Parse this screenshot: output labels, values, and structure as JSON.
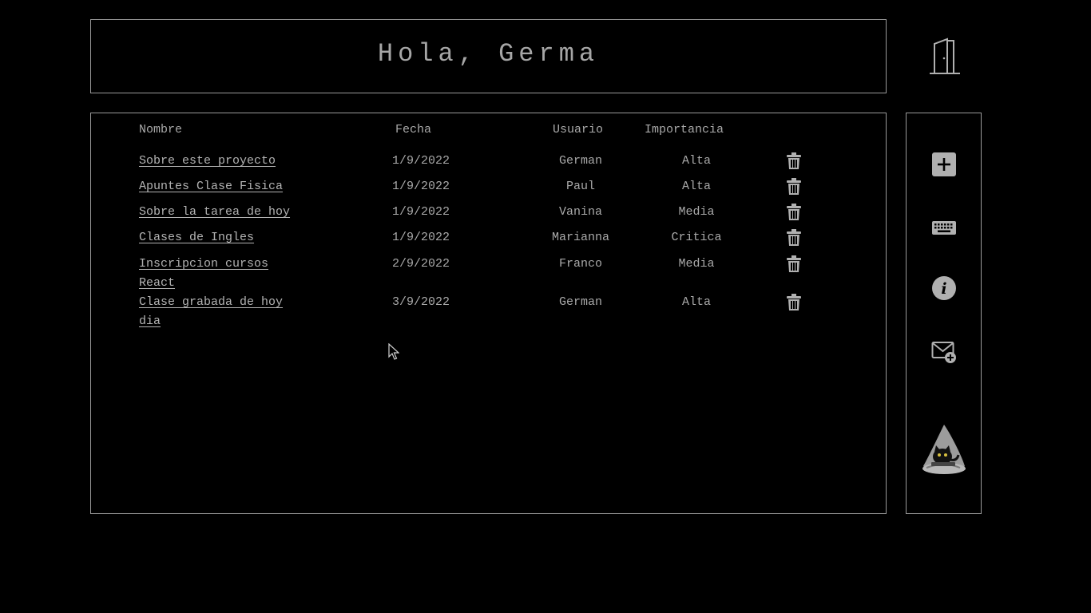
{
  "header": {
    "greeting": "Hola, Germa",
    "logout_icon": "door-icon"
  },
  "table": {
    "columns": {
      "name": "Nombre",
      "date": "Fecha",
      "user": "Usuario",
      "importance": "Importancia"
    },
    "rows": [
      {
        "name": "Sobre este proyecto",
        "date": "1/9/2022",
        "user": "German",
        "importance": "Alta"
      },
      {
        "name": "Apuntes Clase Fisica",
        "date": "1/9/2022",
        "user": "Paul",
        "importance": "Alta"
      },
      {
        "name": "Sobre la tarea de hoy",
        "date": "1/9/2022",
        "user": "Vanina",
        "importance": "Media"
      },
      {
        "name": "Clases de Ingles",
        "date": "1/9/2022",
        "user": "Marianna",
        "importance": "Critica"
      },
      {
        "name": "Inscripcion cursos React",
        "date": "2/9/2022",
        "user": "Franco",
        "importance": "Media"
      },
      {
        "name": "Clase grabada de hoy dia",
        "date": "3/9/2022",
        "user": "German",
        "importance": "Alta"
      }
    ],
    "delete_icon": "trash-icon"
  },
  "sidebar": {
    "items": [
      {
        "icon": "plus-square-icon"
      },
      {
        "icon": "keyboard-icon"
      },
      {
        "icon": "info-icon"
      },
      {
        "icon": "mail-add-icon"
      }
    ],
    "avatar_icon": "cat-wizard-hat-avatar"
  },
  "colors": {
    "background": "#000000",
    "border": "#9a9a9a",
    "text": "#a9a9a9",
    "icon": "#b0b0b0"
  }
}
